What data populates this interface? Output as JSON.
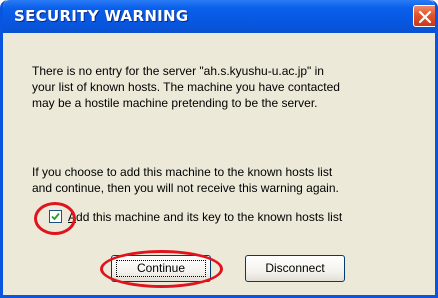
{
  "dialog": {
    "title": "SECURITY WARNING",
    "message1_lines": "There is no entry for the server \"ah.s.kyushu-u.ac.jp\" in\nyour list of known hosts. The machine you have contacted\nmay be a hostile machine pretending to be the server.",
    "message2_lines": "If you choose to add this machine to the known hosts list\nand continue, then you will not receive this warning again.",
    "checkbox_label": "Add this machine and its key to the known hosts list",
    "checkbox_checked": true,
    "continue_label": "Continue",
    "disconnect_label": "Disconnect"
  },
  "colors": {
    "title_bar": "#0a5fea",
    "close_button": "#e2542c",
    "dialog_background": "#ece9d8",
    "annotation": "#e0141c"
  },
  "icons": {
    "close": "close-icon",
    "check": "checkmark-icon"
  }
}
